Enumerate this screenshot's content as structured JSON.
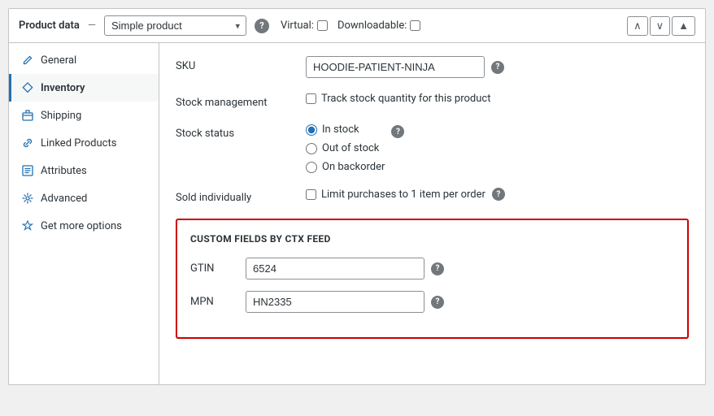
{
  "header": {
    "title": "Product data",
    "separator": "—",
    "product_type": "Simple product",
    "virtual_label": "Virtual:",
    "downloadable_label": "Downloadable:",
    "nav_up": "∧",
    "nav_down": "∨",
    "collapse": "▲"
  },
  "sidebar": {
    "items": [
      {
        "id": "general",
        "label": "General",
        "icon": "pencil"
      },
      {
        "id": "inventory",
        "label": "Inventory",
        "icon": "diamond",
        "active": true
      },
      {
        "id": "shipping",
        "label": "Shipping",
        "icon": "package"
      },
      {
        "id": "linked-products",
        "label": "Linked Products",
        "icon": "link"
      },
      {
        "id": "attributes",
        "label": "Attributes",
        "icon": "list"
      },
      {
        "id": "advanced",
        "label": "Advanced",
        "icon": "gear"
      },
      {
        "id": "get-more-options",
        "label": "Get more options",
        "icon": "star"
      }
    ]
  },
  "main": {
    "fields": {
      "sku": {
        "label": "SKU",
        "value": "HOODIE-PATIENT-NINJA"
      },
      "stock_management": {
        "label": "Stock management",
        "checkbox_label": "Track stock quantity for this product"
      },
      "stock_status": {
        "label": "Stock status",
        "options": [
          {
            "value": "instock",
            "label": "In stock",
            "checked": true
          },
          {
            "value": "outofstock",
            "label": "Out of stock",
            "checked": false
          },
          {
            "value": "onbackorder",
            "label": "On backorder",
            "checked": false
          }
        ]
      },
      "sold_individually": {
        "label": "Sold individually",
        "checkbox_label": "Limit purchases to 1 item per order"
      }
    },
    "custom_fields": {
      "title": "CUSTOM FIELDS by CTX Feed",
      "fields": [
        {
          "id": "gtin",
          "label": "GTIN",
          "value": "6524"
        },
        {
          "id": "mpn",
          "label": "MPN",
          "value": "HN2335"
        }
      ]
    }
  }
}
